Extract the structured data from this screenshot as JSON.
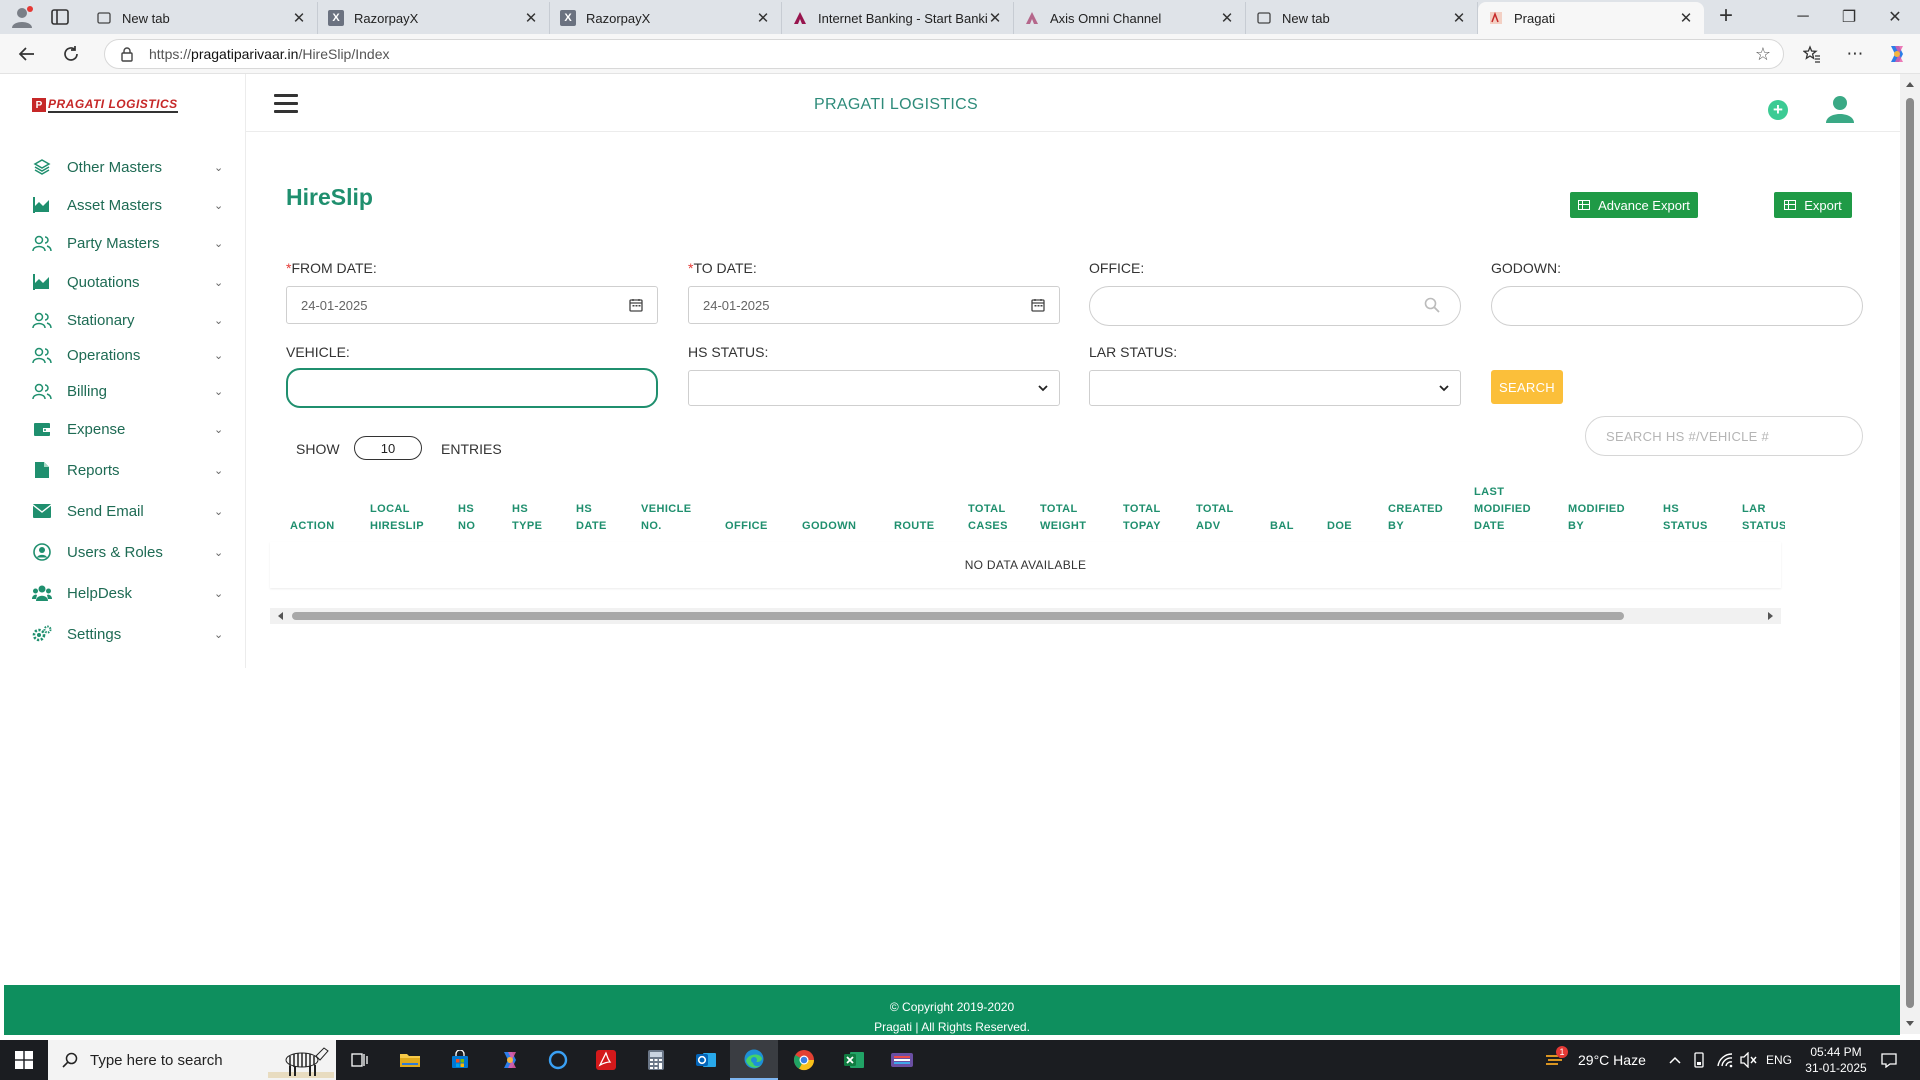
{
  "browser": {
    "tabs": [
      {
        "label": "New tab",
        "favicon": "new-tab-icon"
      },
      {
        "label": "RazorpayX",
        "favicon": "razorpayx-icon"
      },
      {
        "label": "RazorpayX",
        "favicon": "razorpayx-icon"
      },
      {
        "label": "Internet Banking - Start Banking",
        "favicon": "axis-bank-icon"
      },
      {
        "label": "Axis Omni Channel",
        "favicon": "axis-bank-icon"
      },
      {
        "label": "New tab",
        "favicon": "new-tab-icon"
      },
      {
        "label": "Pragati",
        "favicon": "pragati-icon"
      }
    ],
    "active_tab": 6,
    "url_prefix": "https://",
    "url_domain": "pragatiparivaar.in",
    "url_path": "/HireSlip/Index"
  },
  "app": {
    "logo_text": "PRAGATI LOGISTICS",
    "brand_title": "PRAGATI LOGISTICS",
    "accent": "#1f8f6e",
    "menu": [
      {
        "label": "Other Masters",
        "icon": "layers-icon"
      },
      {
        "label": "Asset Masters",
        "icon": "area-chart-icon"
      },
      {
        "label": "Party Masters",
        "icon": "users-icon"
      },
      {
        "label": "Quotations",
        "icon": "area-chart-icon"
      },
      {
        "label": "Stationary",
        "icon": "users-icon"
      },
      {
        "label": "Operations",
        "icon": "users-icon"
      },
      {
        "label": "Billing",
        "icon": "users-icon"
      },
      {
        "label": "Expense",
        "icon": "wallet-icon"
      },
      {
        "label": "Reports",
        "icon": "file-icon"
      },
      {
        "label": "Send Email",
        "icon": "envelope-icon"
      },
      {
        "label": "Users & Roles",
        "icon": "user-circle-icon"
      },
      {
        "label": "HelpDesk",
        "icon": "group-icon"
      },
      {
        "label": "Settings",
        "icon": "cogs-icon"
      }
    ]
  },
  "page": {
    "title": "HireSlip",
    "advance_export_label": "Advance Export",
    "export_label": "Export",
    "filters": {
      "from_date_label": "FROM DATE:",
      "from_date_value": "24-01-2025",
      "to_date_label": "TO DATE:",
      "to_date_value": "24-01-2025",
      "required_mark": "*",
      "office_label": "OFFICE:",
      "godown_label": "GODOWN:",
      "vehicle_label": "VEHICLE:",
      "hs_status_label": "HS STATUS:",
      "lar_status_label": "LAR STATUS:",
      "search_label": "SEARCH"
    },
    "show_label": "SHOW",
    "entries_value": "10",
    "entries_label": "ENTRIES",
    "table_search_placeholder": "SEARCH HS #/VEHICLE #",
    "columns": [
      [
        "ACTION"
      ],
      [
        "LOCAL",
        "HIRESLIP"
      ],
      [
        "HS",
        "NO"
      ],
      [
        "HS",
        "TYPE"
      ],
      [
        "HS",
        "DATE"
      ],
      [
        "VEHICLE",
        "NO."
      ],
      [
        "OFFICE"
      ],
      [
        "GODOWN"
      ],
      [
        "ROUTE"
      ],
      [
        "TOTAL",
        "CASES"
      ],
      [
        "TOTAL",
        "WEIGHT"
      ],
      [
        "TOTAL",
        "TOPAY"
      ],
      [
        "TOTAL",
        "ADV"
      ],
      [
        "BAL"
      ],
      [
        "DOE"
      ],
      [
        "CREATED",
        "BY"
      ],
      [
        "LAST",
        "MODIFIED",
        "DATE"
      ],
      [
        "MODIFIED",
        "BY"
      ],
      [
        "HS",
        "STATUS"
      ],
      [
        "LAR",
        "STATUS"
      ]
    ],
    "no_data_text": "NO DATA AVAILABLE"
  },
  "footer": {
    "line1": "© Copyright 2019-2020",
    "line2": "Pragati | All Rights Reserved."
  },
  "taskbar": {
    "search_placeholder": "Type here to search",
    "weather": "29°C  Haze",
    "notification_count": "1",
    "language": "ENG",
    "time": "05:44 PM",
    "date": "31-01-2025"
  }
}
